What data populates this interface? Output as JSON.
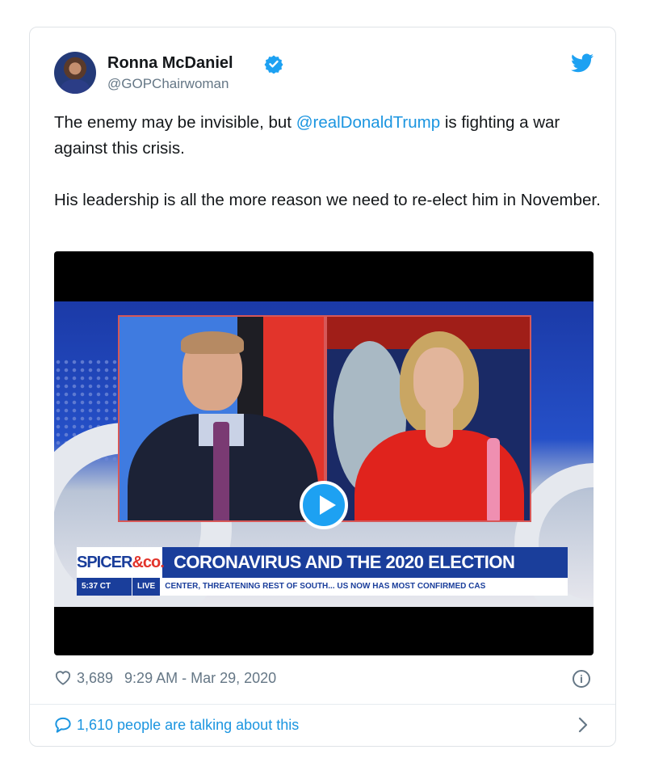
{
  "tweet": {
    "author": {
      "name": "Ronna McDaniel",
      "handle": "@GOPChairwoman",
      "verified": true
    },
    "text": {
      "p1_before": "The enemy may be invisible, but ",
      "p1_mention": "@realDonaldTrump",
      "p1_after": " is fighting a war against this crisis.",
      "p2": "His leadership is all the more reason we need to re-elect him in November."
    },
    "video": {
      "brand_main": "SPICER",
      "brand_amp": "&co.",
      "headline": "CORONAVIRUS AND THE 2020 ELECTION",
      "ticker_time": "5:37 CT",
      "ticker_live": "LIVE",
      "ticker_text": "CENTER, THREATENING REST OF SOUTH...    US NOW HAS MOST CONFIRMED CAS"
    },
    "likes": "3,689",
    "timestamp": "9:29 AM - Mar 29, 2020",
    "info_glyph": "i",
    "talking": "1,610 people are talking about this"
  },
  "colors": {
    "twitter_blue": "#1da1f2",
    "link_blue": "#1b95e0",
    "text_dark": "#14171a",
    "text_gray": "#657786"
  },
  "icons": [
    "verified-badge-icon",
    "twitter-bird-icon",
    "play-icon",
    "heart-icon",
    "info-icon",
    "speech-bubble-icon",
    "chevron-right-icon"
  ]
}
